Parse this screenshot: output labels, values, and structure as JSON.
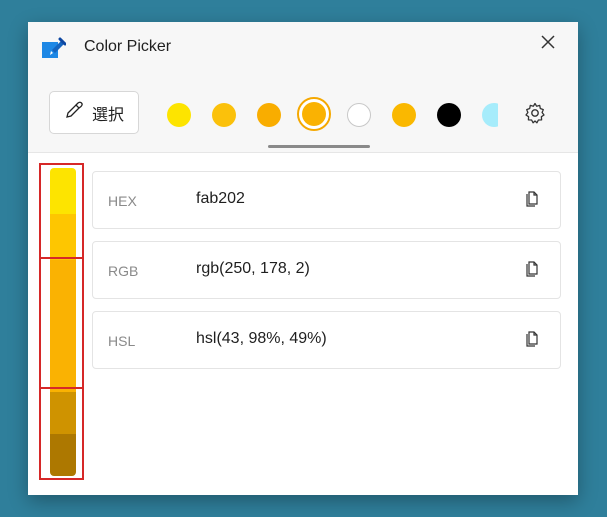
{
  "window": {
    "title": "Color Picker",
    "close_icon": "close-icon",
    "app_icon": "color-picker-app-icon"
  },
  "toolbar": {
    "select_label": "選択",
    "select_icon": "eyedropper-icon",
    "settings_icon": "gear-icon"
  },
  "swatches": [
    {
      "color": "#fde400",
      "selected": false
    },
    {
      "color": "#fbc10b",
      "selected": false
    },
    {
      "color": "#f9ad00",
      "selected": false
    },
    {
      "color": "#fab202",
      "selected": true
    },
    {
      "color": "#ffffff",
      "selected": false
    },
    {
      "color": "#fab800",
      "selected": false
    },
    {
      "color": "#000000",
      "selected": false
    },
    {
      "color": "#a6ecfb",
      "selected": false
    }
  ],
  "color_bar": {
    "segments": [
      "#fde400",
      "#fec600",
      "#fab202",
      "#fab202",
      "#cf9300",
      "#ad7800"
    ]
  },
  "values": [
    {
      "label": "HEX",
      "value": "fab202"
    },
    {
      "label": "RGB",
      "value": "rgb(250, 178, 2)"
    },
    {
      "label": "HSL",
      "value": "hsl(43, 98%, 49%)"
    }
  ],
  "colors": {
    "accent_ring": "#f5a800",
    "marker": "#d62828",
    "background": "#2f7f9b"
  }
}
